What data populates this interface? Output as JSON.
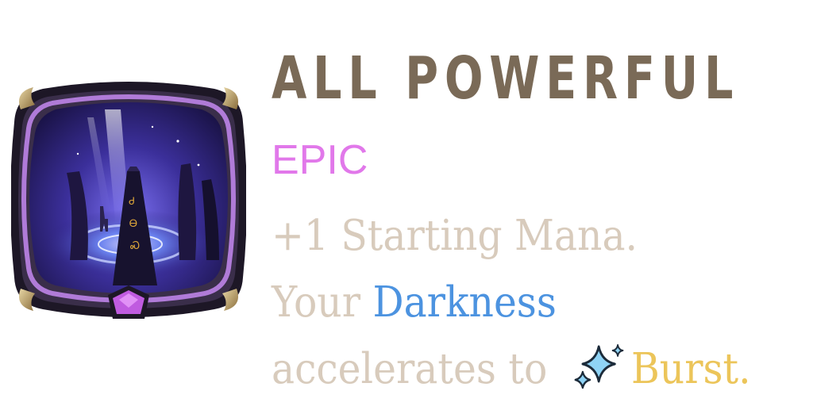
{
  "card": {
    "title": "ALL POWERFUL",
    "rarity": "EPIC",
    "description": {
      "line1": "+1 Starting Mana.",
      "line2_prefix": "Your ",
      "line2_keyword": "Darkness",
      "line3_prefix": "accelerates to ",
      "line3_keyword": "Burst."
    },
    "icons": {
      "artwork": "dark-obelisk-portal-icon",
      "rarity_gem": "epic-gem-icon",
      "burst": "sparkles-icon"
    },
    "colors": {
      "title": "#7a6a57",
      "rarity": "#e178ea",
      "description": "#d8cbbc",
      "darkness_keyword": "#4c93e0",
      "burst_keyword": "#ecc55a",
      "frame": "#2a2238",
      "frame_accent": "#b07bd8",
      "gem": "#c05be0"
    }
  }
}
